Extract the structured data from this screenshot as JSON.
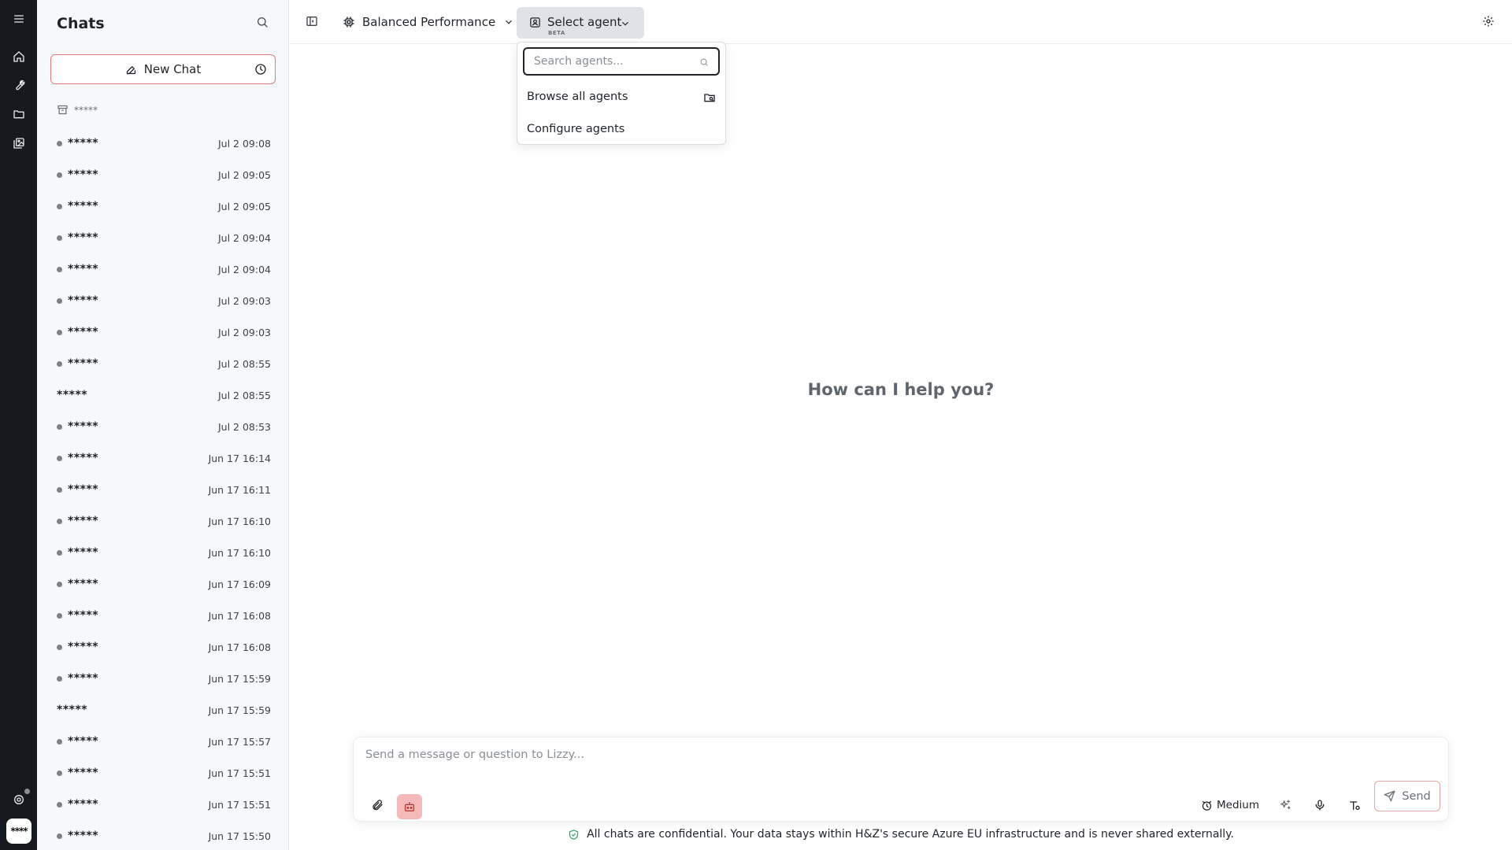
{
  "sidebar": {
    "title": "Chats",
    "new_chat_label": "New Chat",
    "archived_label": "*****",
    "chats": [
      {
        "name": "*****",
        "time": "Jul 2 09:08",
        "dot": true
      },
      {
        "name": "*****",
        "time": "Jul 2 09:05",
        "dot": true
      },
      {
        "name": "*****",
        "time": "Jul 2 09:05",
        "dot": true
      },
      {
        "name": "*****",
        "time": "Jul 2 09:04",
        "dot": true
      },
      {
        "name": "*****",
        "time": "Jul 2 09:04",
        "dot": true
      },
      {
        "name": "*****",
        "time": "Jul 2 09:03",
        "dot": true
      },
      {
        "name": "*****",
        "time": "Jul 2 09:03",
        "dot": true
      },
      {
        "name": "*****",
        "time": "Jul 2 08:55",
        "dot": true
      },
      {
        "name": "*****",
        "time": "Jul 2 08:55",
        "dot": false
      },
      {
        "name": "*****",
        "time": "Jul 2 08:53",
        "dot": true
      },
      {
        "name": "*****",
        "time": "Jun 17 16:14",
        "dot": true
      },
      {
        "name": "*****",
        "time": "Jun 17 16:11",
        "dot": true
      },
      {
        "name": "*****",
        "time": "Jun 17 16:10",
        "dot": true
      },
      {
        "name": "*****",
        "time": "Jun 17 16:10",
        "dot": true
      },
      {
        "name": "*****",
        "time": "Jun 17 16:09",
        "dot": true
      },
      {
        "name": "*****",
        "time": "Jun 17 16:08",
        "dot": true
      },
      {
        "name": "*****",
        "time": "Jun 17 16:08",
        "dot": true
      },
      {
        "name": "*****",
        "time": "Jun 17 15:59",
        "dot": true
      },
      {
        "name": "*****",
        "time": "Jun 17 15:59",
        "dot": false
      },
      {
        "name": "*****",
        "time": "Jun 17 15:57",
        "dot": true
      },
      {
        "name": "*****",
        "time": "Jun 17 15:51",
        "dot": true
      },
      {
        "name": "*****",
        "time": "Jun 17 15:51",
        "dot": true
      },
      {
        "name": "*****",
        "time": "Jun 17 15:50",
        "dot": true
      }
    ]
  },
  "rail": {
    "user_initials": "****"
  },
  "topbar": {
    "model_label": "Balanced Performance",
    "agent_label": "Select agent",
    "agent_badge": "BETA"
  },
  "dropdown": {
    "search_placeholder": "Search agents...",
    "browse_label": "Browse all agents",
    "configure_label": "Configure agents"
  },
  "main": {
    "greeting": "How can I help you?"
  },
  "composer": {
    "placeholder": "Send a message or question to Lizzy...",
    "effort_label": "Medium",
    "send_label": "Send"
  },
  "footer": {
    "disclaimer": "All chats are confidential. Your data stays within H&Z's secure Azure EU infrastructure and is never shared externally."
  },
  "colors": {
    "rail_bg": "#16191d",
    "accent": "#e07a7a",
    "agent_toggle_bg": "#f4b9b9",
    "shield_green": "#3aa56a"
  }
}
